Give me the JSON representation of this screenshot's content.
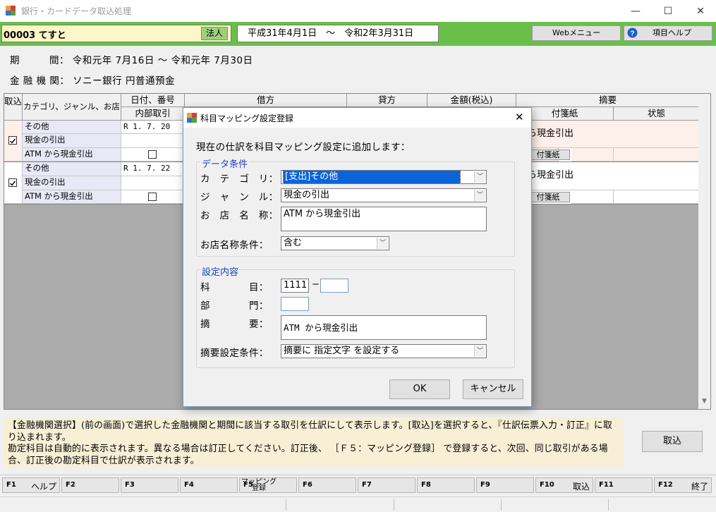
{
  "window": {
    "title": "銀行・カードデータ取込処理",
    "minimize": "—",
    "maximize": "☐",
    "close": "✕"
  },
  "header": {
    "company_code": "00003 てすと",
    "corp_type": "法人",
    "fiscal_period": "平成31年4月1日　～　令和2年3月31日",
    "web_menu": "Webメニュー",
    "item_help": "項目ヘルプ"
  },
  "info": {
    "period_label": "期　　　間：",
    "period_value": "令和元年 7月16日 ～ 令和元年 7月30日",
    "bank_label": "金 融 機 関：",
    "bank_value": "ソニー銀行 円普通預金"
  },
  "grid": {
    "headers": {
      "import": "取込",
      "category": "カテゴリ、ジャンル、お店",
      "date": "日付、番号",
      "internal": "内部取引",
      "debit": "借方",
      "credit": "貸方",
      "amount": "金額(税込)",
      "summary": "摘要",
      "sticky": "付箋紙",
      "status": "状態"
    },
    "rows": [
      {
        "category": "その他",
        "genre": "現金の引出",
        "shop": "ATM から現金引出",
        "date": "R  1. 7. 20",
        "summary": "から現金引出",
        "sticky_btn": "付箋紙"
      },
      {
        "category": "その他",
        "genre": "現金の引出",
        "shop": "ATM から現金引出",
        "date": "R  1. 7. 22",
        "summary": "から現金引出",
        "sticky_btn": "付箋紙"
      }
    ]
  },
  "dialog": {
    "title": "科目マッピング設定登録",
    "message": "現在の仕訳を科目マッピング設定に追加します：",
    "group1": "データ条件",
    "category_label": "カ　テ　ゴ　リ：",
    "category_value": "[支出]その他",
    "genre_label": "ジ　ャ　ン　ル：",
    "genre_value": "現金の引出",
    "shop_label": "お　店　名　称：",
    "shop_value": "ATM から現金引出",
    "shop_cond_label": "お店名称条件：",
    "shop_cond_value": "含む",
    "group2": "設定内容",
    "account_label": "科　　　　目：",
    "account_value": "1111",
    "account_dash": "−",
    "account_sub": "",
    "dept_label": "部　　　　門：",
    "dept_value": "",
    "summary_label": "摘　　　　要：",
    "summary_value": "ATM から現金引出",
    "summary_cond_label": "摘要設定条件：",
    "summary_cond_value": "摘要に 指定文字 を設定する",
    "ok": "OK",
    "cancel": "キャンセル"
  },
  "message": "【金融機関選択】(前の画面)で選択した金融機関と期間に該当する取引を仕訳にして表示します。[取込]を選択すると、『仕訳伝票入力・訂正』に取り込まれます。\n勘定科目は自動的に表示されます。異なる場合は訂正してください。訂正後、 ［Ｆ５：マッピング登録］ で登録すると、次回、同じ取引がある場合、訂正後の勘定科目で仕訳が表示されます。",
  "import_button": "取込",
  "fkeys": [
    {
      "key": "F1",
      "label": "ヘルプ"
    },
    {
      "key": "F2",
      "label": ""
    },
    {
      "key": "F3",
      "label": ""
    },
    {
      "key": "F4",
      "label": ""
    },
    {
      "key": "F5",
      "label": "マッピング\n登録"
    },
    {
      "key": "F6",
      "label": ""
    },
    {
      "key": "F7",
      "label": ""
    },
    {
      "key": "F8",
      "label": ""
    },
    {
      "key": "F9",
      "label": ""
    },
    {
      "key": "F10",
      "label": "取込"
    },
    {
      "key": "F11",
      "label": ""
    },
    {
      "key": "F12",
      "label": "終了"
    }
  ]
}
